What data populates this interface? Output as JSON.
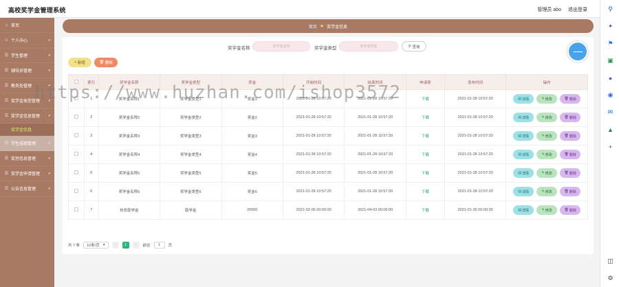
{
  "header": {
    "title": "高校奖学金管理系统",
    "admin": "管理员 abo",
    "logout": "退出登录"
  },
  "sidebar": {
    "items": [
      {
        "label": "首页",
        "icon": "home-icon"
      },
      {
        "label": "个人中心",
        "icon": "user-icon",
        "chevron": true
      },
      {
        "label": "学生管理",
        "icon": "menu-icon",
        "chevron": true
      },
      {
        "label": "辅导员管理",
        "icon": "menu-icon",
        "chevron": true
      },
      {
        "label": "教务处管理",
        "icon": "menu-icon",
        "chevron": true
      },
      {
        "label": "奖学金类型管理",
        "icon": "menu-icon",
        "chevron": true
      },
      {
        "label": "奖学金信息管理",
        "icon": "menu-icon",
        "chevron": true
      },
      {
        "label": "奖学金信息",
        "sub": true
      },
      {
        "label": "学生成绩管理",
        "icon": "menu-icon",
        "chevron": true,
        "active": true
      },
      {
        "label": "奖惩信息管理",
        "icon": "menu-icon",
        "chevron": true
      },
      {
        "label": "奖学金申请管理",
        "icon": "menu-icon",
        "chevron": true
      },
      {
        "label": "公告信息管理",
        "icon": "menu-icon",
        "chevron": true
      }
    ]
  },
  "breadcrumb": {
    "home": "首页",
    "current": "奖学金信息"
  },
  "search": {
    "name_label": "奖学金名称",
    "name_placeholder": "奖学金名称",
    "type_label": "奖学金类型",
    "type_placeholder": "奖学金类型",
    "query_label": "查询"
  },
  "actions": {
    "add": "新增",
    "delete": "删除"
  },
  "table": {
    "headers": [
      "索引",
      "奖学金名称",
      "奖学金类型",
      "奖金",
      "开始时间",
      "结束时间",
      "申请表",
      "发布时间",
      "操作"
    ],
    "rows": [
      {
        "idx": "1",
        "name": "奖学金名称1",
        "type": "奖学金类型1",
        "amount": "奖金1",
        "start": "2021-01-28 10:57:20",
        "end": "2021-01-28 10:57:20",
        "form": "下载",
        "pub": "2021-01-28 10:57:20"
      },
      {
        "idx": "2",
        "name": "奖学金名称2",
        "type": "奖学金类型2",
        "amount": "奖金2",
        "start": "2021-01-28 10:57:20",
        "end": "2021-01-28 10:57:20",
        "form": "下载",
        "pub": "2021-01-28 10:57:20"
      },
      {
        "idx": "3",
        "name": "奖学金名称3",
        "type": "奖学金类型3",
        "amount": "奖金3",
        "start": "2021-01-28 10:57:20",
        "end": "2021-01-28 10:57:20",
        "form": "下载",
        "pub": "2021-01-28 10:57:20"
      },
      {
        "idx": "4",
        "name": "奖学金名称4",
        "type": "奖学金类型4",
        "amount": "奖金4",
        "start": "2021-01-28 10:57:20",
        "end": "2021-01-28 10:57:20",
        "form": "下载",
        "pub": "2021-01-28 10:57:20"
      },
      {
        "idx": "5",
        "name": "奖学金名称5",
        "type": "奖学金类型5",
        "amount": "奖金5",
        "start": "2021-01-28 10:57:20",
        "end": "2021-01-28 10:57:20",
        "form": "下载",
        "pub": "2021-01-28 10:57:20"
      },
      {
        "idx": "6",
        "name": "奖学金名称6",
        "type": "奖学金类型6",
        "amount": "奖金6",
        "start": "2021-01-28 10:57:20",
        "end": "2021-01-28 10:57:20",
        "form": "下载",
        "pub": "2021-01-28 10:57:20"
      },
      {
        "idx": "7",
        "name": "扶贫助学金",
        "type": "助学金",
        "amount": "20000",
        "start": "2021-02-06 00:00:00",
        "end": "2021-04-03 00:00:00",
        "form": "下载",
        "pub": "2021-01-30 00:00:00"
      }
    ],
    "ops": {
      "detail": "详情",
      "edit": "修改",
      "remove": "删除"
    }
  },
  "pager": {
    "total": "共 7 条",
    "size": "10条/页",
    "prev": "‹",
    "current": "1",
    "next": "›",
    "goto": "前往",
    "page": "1",
    "unit": "页"
  },
  "watermark": "https://www.huzhan.com/ishop3572",
  "colors": {
    "sidebar": "#a87a64",
    "accent_green": "#2fb57a",
    "header_row": "#f6eeea"
  }
}
